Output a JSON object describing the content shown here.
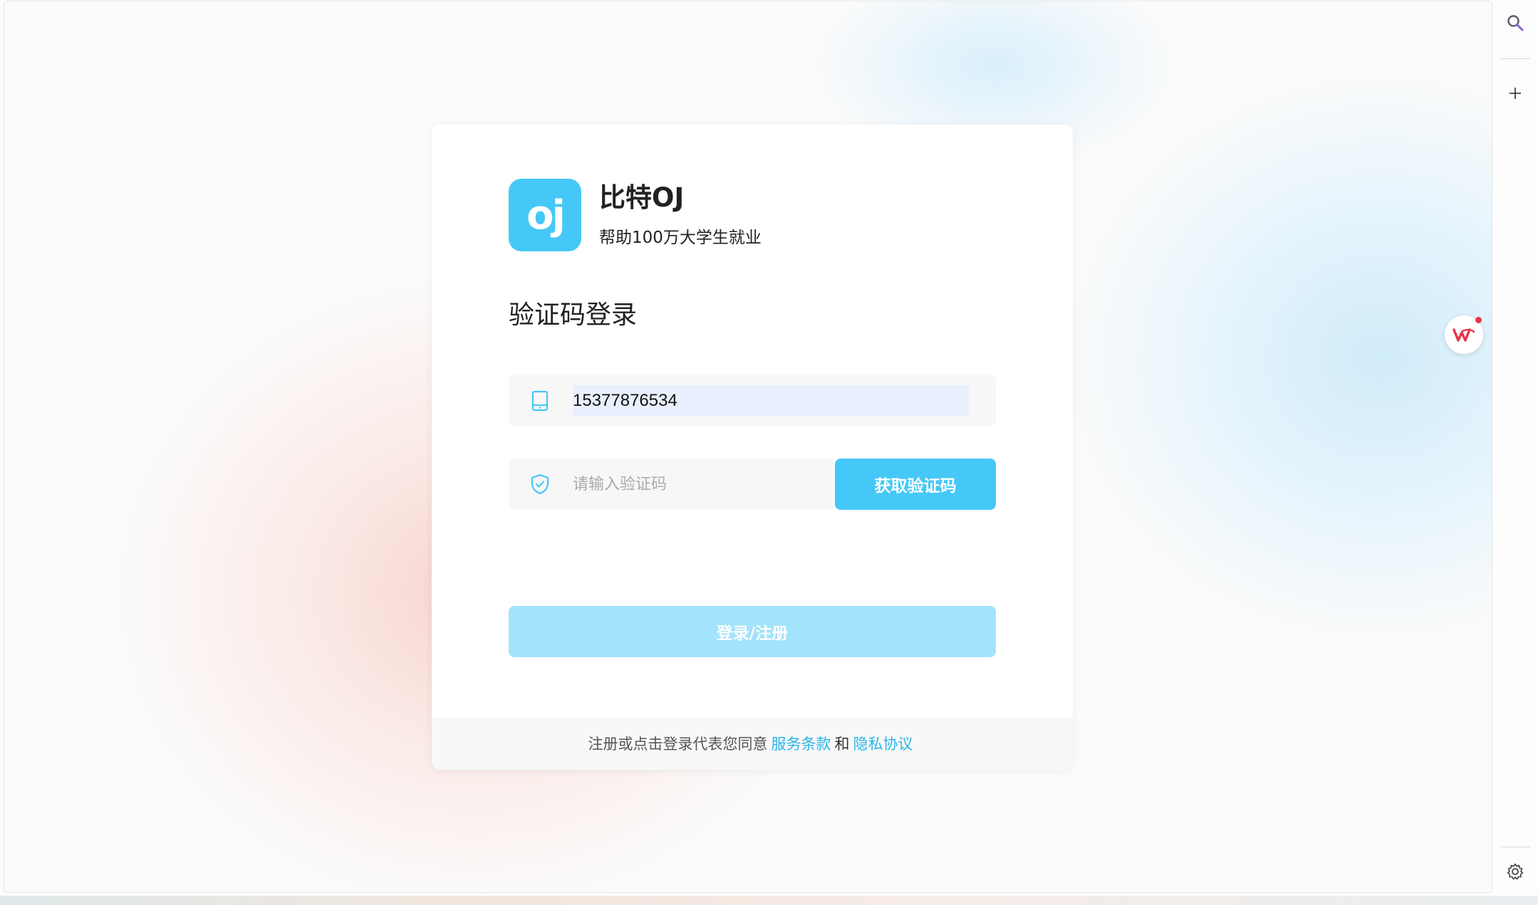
{
  "brand": {
    "logo_text": "oj",
    "name": "比特OJ",
    "slogan": "帮助100万大学生就业"
  },
  "login": {
    "heading": "验证码登录",
    "phone": {
      "value": "15377876534",
      "icon": "tablet-icon"
    },
    "code": {
      "placeholder": "请输入验证码",
      "icon": "shield-check-icon"
    },
    "get_code_label": "获取验证码",
    "submit_label": "登录/注册"
  },
  "footer": {
    "prefix": "注册或点击登录代表您同意",
    "terms_label": "服务条款",
    "join": "和",
    "privacy_label": "隐私协议"
  },
  "sidebar": {
    "search_icon": "search-icon",
    "add_icon": "plus-icon",
    "settings_icon": "gear-icon"
  },
  "colors": {
    "accent": "#45c8f7",
    "accent_disabled": "#a3e3fb",
    "link": "#2bb4ea",
    "wps_red": "#e8334a"
  }
}
